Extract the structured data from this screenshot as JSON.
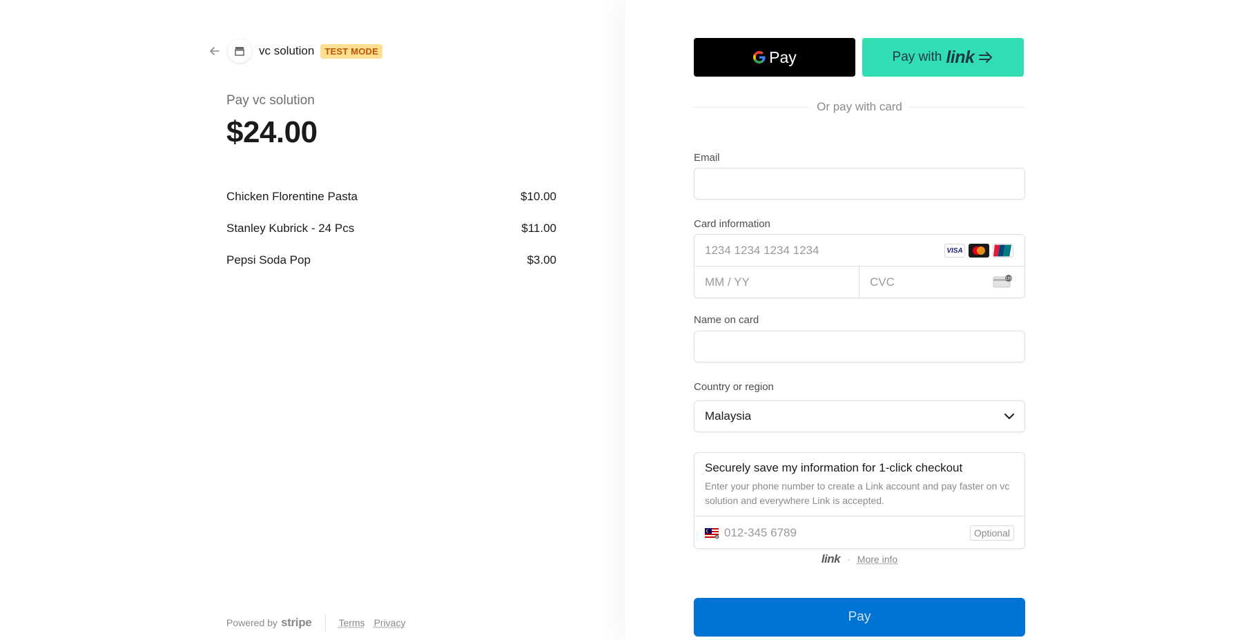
{
  "summary": {
    "merchant": "vc solution",
    "test_mode": "TEST MODE",
    "pay_label": "Pay vc solution",
    "amount": "$24.00",
    "items": [
      {
        "name": "Chicken Florentine Pasta",
        "price": "$10.00"
      },
      {
        "name": "Stanley Kubrick - 24 Pcs",
        "price": "$11.00"
      },
      {
        "name": "Pepsi Soda Pop",
        "price": "$3.00"
      }
    ],
    "footer": {
      "powered_by": "Powered by",
      "stripe": "stripe",
      "terms": "Terms",
      "privacy": "Privacy"
    }
  },
  "wallets": {
    "gpay_label": "Pay",
    "link_prefix": "Pay with",
    "link_word": "link"
  },
  "divider": "Or pay with card",
  "form": {
    "email_label": "Email",
    "email_value": "",
    "card_label": "Card information",
    "card_number_placeholder": "1234 1234 1234 1234",
    "expiry_placeholder": "MM / YY",
    "cvc_placeholder": "CVC",
    "card_brands": [
      "VISA",
      "mastercard",
      "UnionPay"
    ],
    "name_label": "Name on card",
    "name_value": "",
    "country_label": "Country or region",
    "country_value": "Malaysia"
  },
  "save_info": {
    "title": "Securely save my information for 1-click checkout",
    "description": "Enter your phone number to create a Link account and pay faster on vc solution and everywhere Link is accepted.",
    "phone_placeholder": "012-345 6789",
    "optional": "Optional"
  },
  "link_info": {
    "brand": "link",
    "separator": "·",
    "more_info": "More info"
  },
  "pay_button": "Pay",
  "colors": {
    "pay_button": "#0074d4",
    "link_button": "#33ddb3",
    "test_badge_bg": "#ffde92",
    "test_badge_text": "#bb5504"
  }
}
